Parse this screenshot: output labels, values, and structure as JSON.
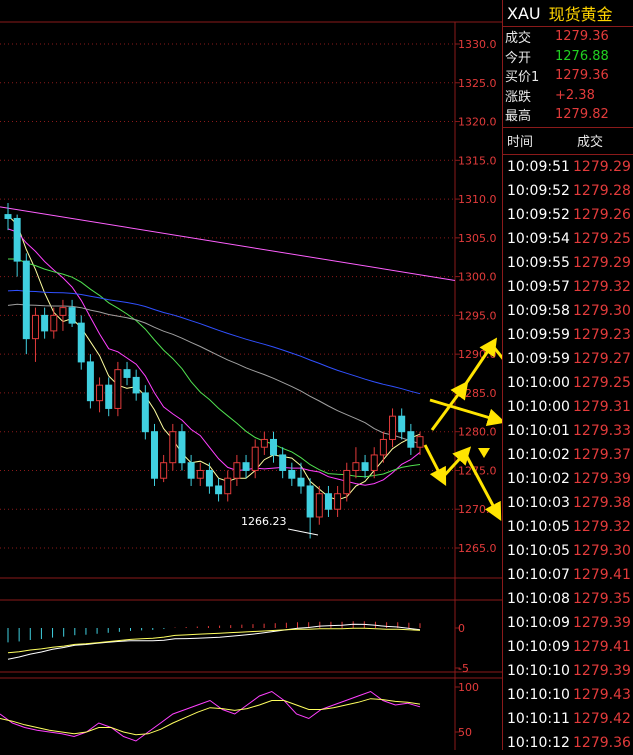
{
  "header": {
    "symbol": "XAU",
    "name": "现货黄金"
  },
  "quote": [
    {
      "label": "成交",
      "value": "1279.36",
      "color": "#e23b3b"
    },
    {
      "label": "今开",
      "value": "1276.88",
      "color": "#21d121"
    },
    {
      "label": "买价1",
      "value": "1279.36",
      "color": "#e23b3b"
    },
    {
      "label": "涨跌",
      "value": "+2.38",
      "color": "#e23b3b"
    },
    {
      "label": "最高",
      "value": "1279.82",
      "color": "#e23b3b"
    }
  ],
  "ticks_header": {
    "time": "时间",
    "price": "成交"
  },
  "ticks": [
    {
      "time": "10:09:51",
      "price": "1279.29"
    },
    {
      "time": "10:09:52",
      "price": "1279.28"
    },
    {
      "time": "10:09:52",
      "price": "1279.26"
    },
    {
      "time": "10:09:54",
      "price": "1279.25"
    },
    {
      "time": "10:09:55",
      "price": "1279.29"
    },
    {
      "time": "10:09:57",
      "price": "1279.32"
    },
    {
      "time": "10:09:58",
      "price": "1279.30"
    },
    {
      "time": "10:09:59",
      "price": "1279.23"
    },
    {
      "time": "10:09:59",
      "price": "1279.27"
    },
    {
      "time": "10:10:00",
      "price": "1279.25"
    },
    {
      "time": "10:10:00",
      "price": "1279.31"
    },
    {
      "time": "10:10:01",
      "price": "1279.33"
    },
    {
      "time": "10:10:02",
      "price": "1279.37"
    },
    {
      "time": "10:10:02",
      "price": "1279.39"
    },
    {
      "time": "10:10:03",
      "price": "1279.38"
    },
    {
      "time": "10:10:05",
      "price": "1279.32"
    },
    {
      "time": "10:10:05",
      "price": "1279.30"
    },
    {
      "time": "10:10:07",
      "price": "1279.41"
    },
    {
      "time": "10:10:08",
      "price": "1279.35"
    },
    {
      "time": "10:10:09",
      "price": "1279.39"
    },
    {
      "time": "10:10:09",
      "price": "1279.41"
    },
    {
      "time": "10:10:10",
      "price": "1279.39"
    },
    {
      "time": "10:10:10",
      "price": "1279.43"
    },
    {
      "time": "10:10:11",
      "price": "1279.42"
    },
    {
      "time": "10:10:12",
      "price": "1279.36"
    }
  ],
  "colors": {
    "up": "#e23b3b",
    "down": "#40d0e0",
    "grid": "#8a1a1a",
    "ma5": "#ffffa0",
    "ma10": "#ff40ff",
    "ma20": "#50e050",
    "ma60": "#3050ff",
    "ma120": "#a0a0a0",
    "ma250": "#ff60ff",
    "arrow": "#ffe400"
  },
  "chart_data": [
    {
      "type": "candlestick",
      "ylim": [
        1262,
        1331
      ],
      "y_ticks": [
        "1330.0",
        "1325.0",
        "1320.0",
        "1315.0",
        "1310.0",
        "1305.0",
        "1300.0",
        "1295.0",
        "1290.0",
        "1285.0",
        "1280.0",
        "1275.0",
        "1270.0",
        "1265.0"
      ],
      "annotation": {
        "text": "1266.23",
        "value": 1266.23
      },
      "candles": [
        [
          1308,
          1309.5,
          1306,
          1307.5
        ],
        [
          1307.5,
          1308,
          1300,
          1302
        ],
        [
          1302,
          1303,
          1290,
          1292
        ],
        [
          1292,
          1296,
          1289,
          1295
        ],
        [
          1295,
          1296,
          1292,
          1293
        ],
        [
          1293,
          1296,
          1292,
          1295
        ],
        [
          1295,
          1297,
          1293,
          1296
        ],
        [
          1296,
          1297,
          1293.5,
          1294
        ],
        [
          1294,
          1295,
          1288,
          1289
        ],
        [
          1289,
          1290,
          1283,
          1284
        ],
        [
          1284,
          1287,
          1282.5,
          1286
        ],
        [
          1286,
          1287,
          1282,
          1283
        ],
        [
          1283,
          1289,
          1282,
          1288
        ],
        [
          1288,
          1289,
          1286,
          1287
        ],
        [
          1287,
          1288,
          1284,
          1285
        ],
        [
          1285,
          1286,
          1279,
          1280
        ],
        [
          1280,
          1281,
          1273,
          1274
        ],
        [
          1274,
          1277,
          1273.5,
          1276
        ],
        [
          1276,
          1281,
          1275,
          1280
        ],
        [
          1280,
          1281,
          1275,
          1276
        ],
        [
          1276,
          1277,
          1273,
          1274
        ],
        [
          1274,
          1276,
          1273,
          1275
        ],
        [
          1275,
          1276,
          1272,
          1273
        ],
        [
          1273,
          1274,
          1271,
          1272
        ],
        [
          1272,
          1275,
          1271,
          1274
        ],
        [
          1274,
          1277,
          1273,
          1276
        ],
        [
          1276,
          1277,
          1274,
          1275
        ],
        [
          1275,
          1279,
          1274,
          1278
        ],
        [
          1278,
          1280,
          1277,
          1279
        ],
        [
          1279,
          1280,
          1276,
          1277
        ],
        [
          1277,
          1278,
          1274,
          1275
        ],
        [
          1275,
          1276,
          1273,
          1274
        ],
        [
          1274,
          1276,
          1272,
          1273
        ],
        [
          1273,
          1274,
          1266.23,
          1269
        ],
        [
          1269,
          1273,
          1268,
          1272
        ],
        [
          1272,
          1273,
          1269,
          1270
        ],
        [
          1270,
          1273,
          1269,
          1272
        ],
        [
          1272,
          1276,
          1271,
          1275
        ],
        [
          1275,
          1278,
          1274,
          1276
        ],
        [
          1276,
          1277,
          1274,
          1275
        ],
        [
          1275,
          1278,
          1274,
          1277
        ],
        [
          1277,
          1280,
          1276,
          1279
        ],
        [
          1279,
          1283,
          1278,
          1282
        ],
        [
          1282,
          1283,
          1279,
          1280
        ],
        [
          1280,
          1281,
          1277,
          1278
        ],
        [
          1278,
          1280,
          1277,
          1279.36
        ]
      ]
    },
    {
      "type": "bar",
      "name": "MACD",
      "y_ticks": [
        "0",
        "-5"
      ],
      "ylim": [
        -5.5,
        3.5
      ],
      "values": [
        -3,
        -2.8,
        -2.5,
        -2.3,
        -2,
        -1.8,
        -1.5,
        -1.4,
        -1.2,
        -1,
        -0.8,
        -0.6,
        -0.5,
        -0.4,
        -0.2,
        0.1,
        0.2,
        0.3,
        0.4,
        0.5,
        0.6,
        0.7,
        0.8,
        0.9,
        1,
        1.1,
        1.2,
        1.2,
        1.3,
        1.3,
        1.3,
        1.4,
        1.4,
        1.3,
        1.2,
        1.2,
        1.1,
        1.0
      ]
    },
    {
      "type": "line",
      "name": "KDJ",
      "y_ticks": [
        "100",
        "50"
      ],
      "ylim": [
        30,
        110
      ],
      "series": [
        {
          "values": [
            70,
            60,
            55,
            52,
            50,
            48,
            45,
            50,
            60,
            55,
            45,
            40,
            50,
            60,
            70,
            75,
            80,
            85,
            75,
            70,
            80,
            90,
            95,
            85,
            70,
            65,
            75,
            80,
            85,
            90,
            95,
            85,
            80,
            82,
            78
          ]
        },
        {
          "values": [
            65,
            62,
            58,
            55,
            52,
            50,
            48,
            50,
            55,
            55,
            50,
            47,
            48,
            53,
            60,
            66,
            72,
            77,
            76,
            74,
            76,
            80,
            85,
            85,
            80,
            75,
            75,
            77,
            80,
            83,
            87,
            86,
            84,
            83,
            81
          ]
        }
      ]
    }
  ]
}
